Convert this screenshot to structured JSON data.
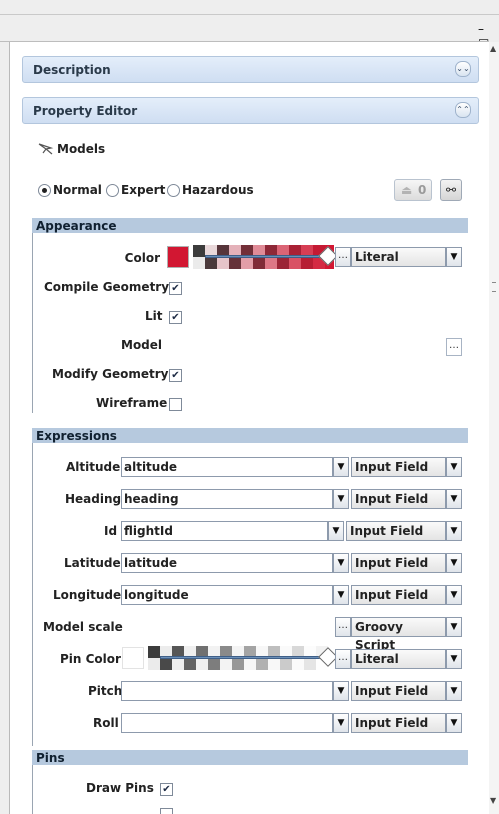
{
  "window": {
    "controls": "– □"
  },
  "sections": {
    "description": {
      "title": "Description",
      "collapsed_icon": "⌄⌄"
    },
    "property_editor": {
      "title": "Property Editor",
      "collapse_icon": "⌃⌃"
    }
  },
  "models": {
    "title": "Models",
    "icon": "models-icon"
  },
  "mode": {
    "options": [
      "Normal",
      "Expert",
      "Hazardous"
    ],
    "selected": "Normal",
    "counter": "0"
  },
  "appearance": {
    "title": "Appearance",
    "color_label": "Color",
    "color_value": "#d21732",
    "color_mode": "Literal",
    "compile_geometry_label": "Compile Geometry",
    "compile_geometry": true,
    "lit_label": "Lit",
    "lit": true,
    "model_label": "Model",
    "modify_geometry_label": "Modify Geometry",
    "modify_geometry": true,
    "wireframe_label": "Wireframe",
    "wireframe": false
  },
  "expressions": {
    "title": "Expressions",
    "rows": [
      {
        "label": "Altitude",
        "value": "altitude",
        "mode": "Input Field"
      },
      {
        "label": "Heading",
        "value": "heading",
        "mode": "Input Field"
      },
      {
        "label": "Id",
        "value": "flightId",
        "mode": "Input Field"
      },
      {
        "label": "Latitude",
        "value": "latitude",
        "mode": "Input Field"
      },
      {
        "label": "Longitude",
        "value": "longitude",
        "mode": "Input Field"
      }
    ],
    "model_scale_label": "Model scale",
    "model_scale_mode": "Groovy Script",
    "pin_color_label": "Pin Color",
    "pin_color_value": "#ffffff",
    "pin_color_mode": "Literal",
    "pitch_label": "Pitch",
    "pitch_mode": "Input Field",
    "roll_label": "Roll",
    "roll_mode": "Input Field"
  },
  "pins": {
    "title": "Pins",
    "draw_pins_label": "Draw Pins",
    "draw_pins": true
  },
  "colors": {
    "section_header": "#d6e3f3",
    "group_bar": "#b6c9de",
    "red": "#d21732"
  }
}
